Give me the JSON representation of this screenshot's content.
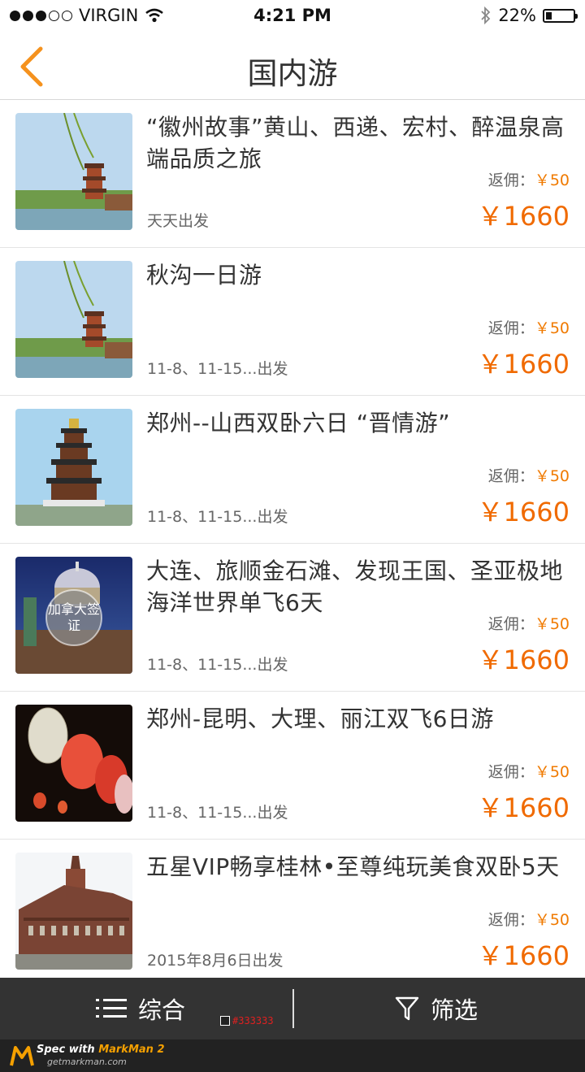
{
  "status": {
    "carrier": "VIRGIN",
    "time": "4:21 PM",
    "battery_text": "22%",
    "battery_level": 0.22
  },
  "nav": {
    "title": "国内游",
    "back_icon": "chevron-left-icon"
  },
  "colors": {
    "accent": "#f5921e",
    "price": "#f06a00",
    "bottom_bar": "#333333"
  },
  "items": [
    {
      "title": "“徽州故事”黄山、西递、宏村、醉温泉高端品质之旅",
      "depart": "天天出发",
      "rebate_label": "返佣：",
      "rebate_value": "￥50",
      "price": "￥1660",
      "image": "pagoda-lake"
    },
    {
      "title": "秋沟一日游",
      "depart": "11-8、11-15...出发",
      "rebate_label": "返佣：",
      "rebate_value": "￥50",
      "price": "￥1660",
      "image": "pagoda-lake"
    },
    {
      "title": "郑州--山西双卧六日 “晋情游”",
      "depart": "11-8、11-15...出发",
      "rebate_label": "返佣：",
      "rebate_value": "￥50",
      "price": "￥1660",
      "image": "tall-pagoda"
    },
    {
      "title": "大连、旅顺金石滩、发现王国、圣亚极地海洋世界单飞6天",
      "depart": "11-8、11-15...出发",
      "rebate_label": "返佣：",
      "rebate_value": "￥50",
      "price": "￥1660",
      "image": "dome-building",
      "badge": "加拿大签证"
    },
    {
      "title": " 郑州-昆明、大理、丽江双飞6日游",
      "depart": "11-8、11-15...出发",
      "rebate_label": "返佣：",
      "rebate_value": "￥50",
      "price": "￥1660",
      "image": "lanterns"
    },
    {
      "title": " 五星VIP畅享桂林•至尊纯玩美食双卧5天",
      "depart": "2015年8月6日出发",
      "rebate_label": "返佣：",
      "rebate_value": "￥50",
      "price": "￥1660",
      "image": "brick-hall"
    }
  ],
  "bottom_bar": {
    "sort_label": "综合",
    "sort_icon": "list-icon",
    "filter_label": "筛选",
    "filter_icon": "filter-icon",
    "spec_color_label": "#333333"
  },
  "watermark": {
    "prefix": "Spec with ",
    "brand": "MarkMan 2",
    "site": "getmarkman.com"
  }
}
